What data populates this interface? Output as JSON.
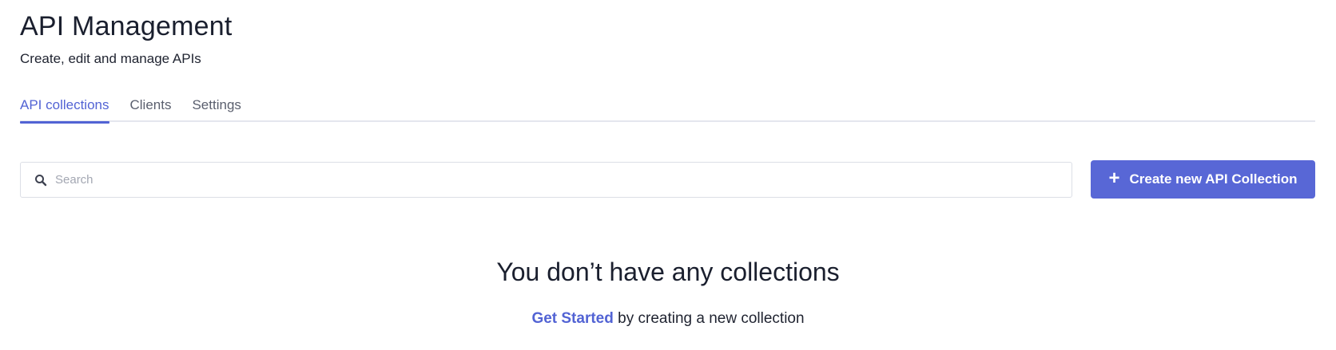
{
  "header": {
    "title": "API Management",
    "subtitle": "Create, edit and manage APIs"
  },
  "tabs": [
    {
      "label": "API collections",
      "active": true
    },
    {
      "label": "Clients",
      "active": false
    },
    {
      "label": "Settings",
      "active": false
    }
  ],
  "search": {
    "placeholder": "Search",
    "value": "",
    "icon": "search-icon"
  },
  "create_button": {
    "label": "Create new API Collection",
    "icon": "plus-icon"
  },
  "empty_state": {
    "title": "You don’t have any collections",
    "link_text": "Get Started",
    "text": "by creating a new collection"
  },
  "colors": {
    "accent": "#5867d6",
    "tab_active": "#5263d4",
    "text_primary": "#1a1f2e",
    "border": "#dcdfe6"
  }
}
